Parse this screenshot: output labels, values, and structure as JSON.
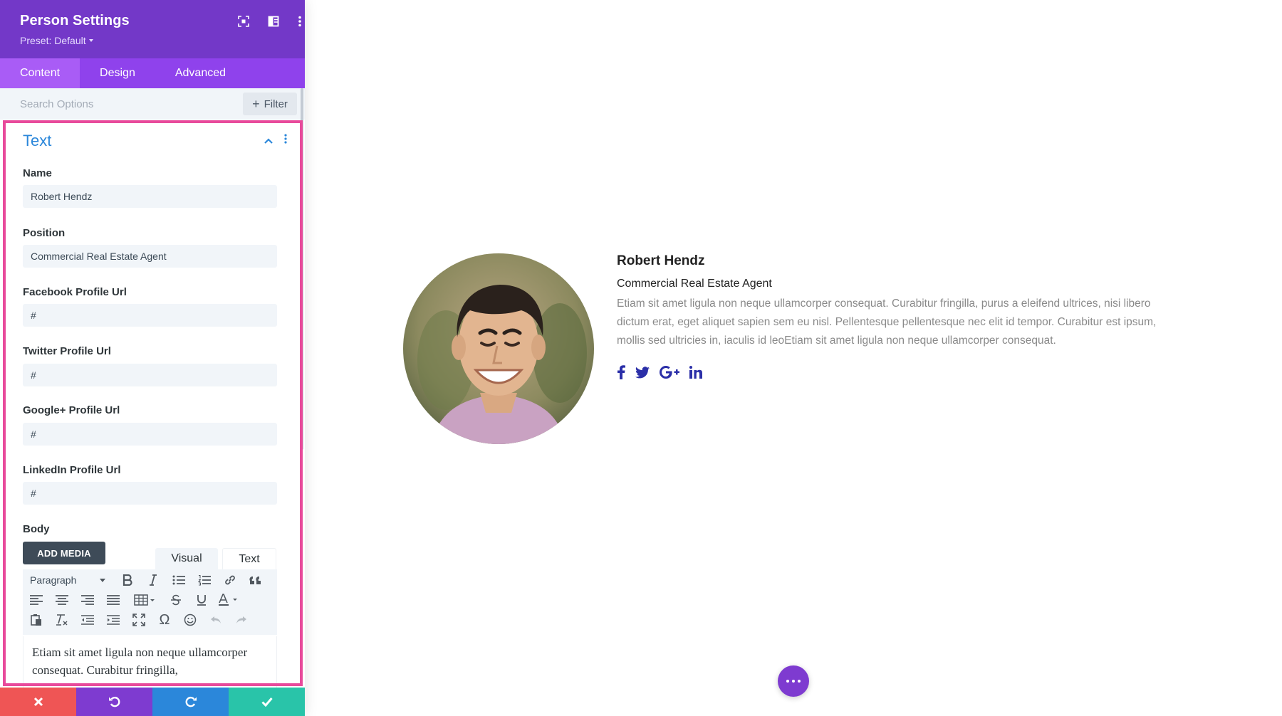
{
  "header": {
    "title": "Person Settings",
    "preset_label": "Preset: Default",
    "icons": [
      "expand-icon",
      "sidebar-layout-icon",
      "more-vertical-icon"
    ]
  },
  "tabs": [
    {
      "label": "Content",
      "active": true
    },
    {
      "label": "Design",
      "active": false
    },
    {
      "label": "Advanced",
      "active": false
    }
  ],
  "search": {
    "placeholder": "Search Options",
    "filter_label": "Filter"
  },
  "group": {
    "title": "Text",
    "expanded": true
  },
  "fields": {
    "name": {
      "label": "Name",
      "value": "Robert Hendz"
    },
    "position": {
      "label": "Position",
      "value": "Commercial Real Estate Agent"
    },
    "facebook": {
      "label": "Facebook Profile Url",
      "value": "#"
    },
    "twitter": {
      "label": "Twitter Profile Url",
      "value": "#"
    },
    "googleplus": {
      "label": "Google+ Profile Url",
      "value": "#"
    },
    "linkedin": {
      "label": "LinkedIn Profile Url",
      "value": "#"
    },
    "body": {
      "label": "Body"
    }
  },
  "editor": {
    "add_media_label": "ADD MEDIA",
    "tab_visual": "Visual",
    "tab_text": "Text",
    "format_select": "Paragraph",
    "content": "Etiam sit amet ligula non neque ullamcorper consequat. Curabitur fringilla,"
  },
  "footer": {
    "buttons": [
      "discard-icon",
      "undo-icon",
      "redo-icon",
      "save-icon"
    ]
  },
  "preview": {
    "name": "Robert Hendz",
    "position": "Commercial Real Estate Agent",
    "body": "Etiam sit amet ligula non neque ullamcorper consequat. Curabitur fringilla, purus a eleifend ultrices, nisi libero dictum erat, eget aliquet sapien sem eu nisl. Pellentesque pellentesque nec elit id tempor. Curabitur est ipsum, mollis sed ultricies in, iaculis id leoEtiam sit amet ligula non neque ullamcorper consequat.",
    "social_icons": [
      "facebook-icon",
      "twitter-icon",
      "google-plus-icon",
      "linkedin-icon"
    ]
  },
  "colors": {
    "header": "#7338c8",
    "tabs_bar": "#8f42ec",
    "tab_active": "#a95cf6",
    "group_title": "#2b87da",
    "focus_border": "#e84a9b",
    "discard": "#ef5555",
    "undo": "#7e3bd0",
    "redo": "#2b87da",
    "save": "#29c4a9",
    "social": "#2b2fa8"
  }
}
